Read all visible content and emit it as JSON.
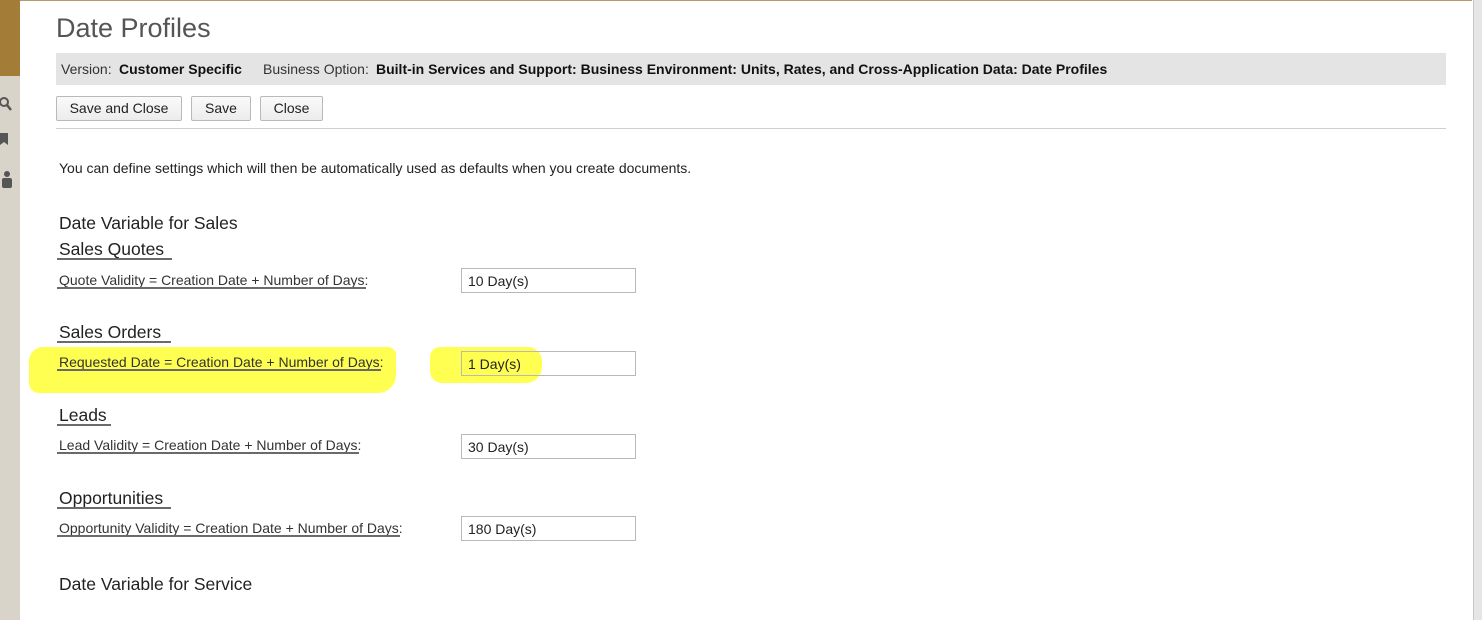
{
  "dialog": {
    "title": "Date Profiles",
    "info": {
      "version_label": "Version:",
      "version_value": "Customer Specific",
      "business_option_label": "Business Option:",
      "business_option_value": "Built-in Services and Support: Business Environment: Units, Rates, and Cross-Application Data: Date Profiles"
    },
    "toolbar": {
      "save_close_label": "Save and Close",
      "save_label": "Save",
      "close_label": "Close"
    },
    "intro_text": "You can define settings which will then be automatically used as defaults when you create documents.",
    "sales_section_title": "Date Variable for Sales",
    "groups": [
      {
        "title": "Sales Quotes",
        "label": "Quote Validity = Creation Date + Number of Days:",
        "value": "10 Day(s)"
      },
      {
        "title": "Sales Orders",
        "label": "Requested Date = Creation Date + Number of Days:",
        "value": "1 Day(s)"
      },
      {
        "title": "Leads",
        "label": "Lead Validity = Creation Date + Number of Days:",
        "value": "30 Day(s)"
      },
      {
        "title": "Opportunities",
        "label": "Opportunity Validity = Creation Date + Number of Days:",
        "value": "180 Day(s)"
      }
    ],
    "service_section_title": "Date Variable for Service"
  },
  "colors": {
    "highlight": "#ffff33",
    "info_bar_bg": "#e4e4e4",
    "left_strip_accent": "#a37c37"
  },
  "icons": {
    "left_strip": [
      "search-icon",
      "flag-icon",
      "user-icon"
    ]
  }
}
